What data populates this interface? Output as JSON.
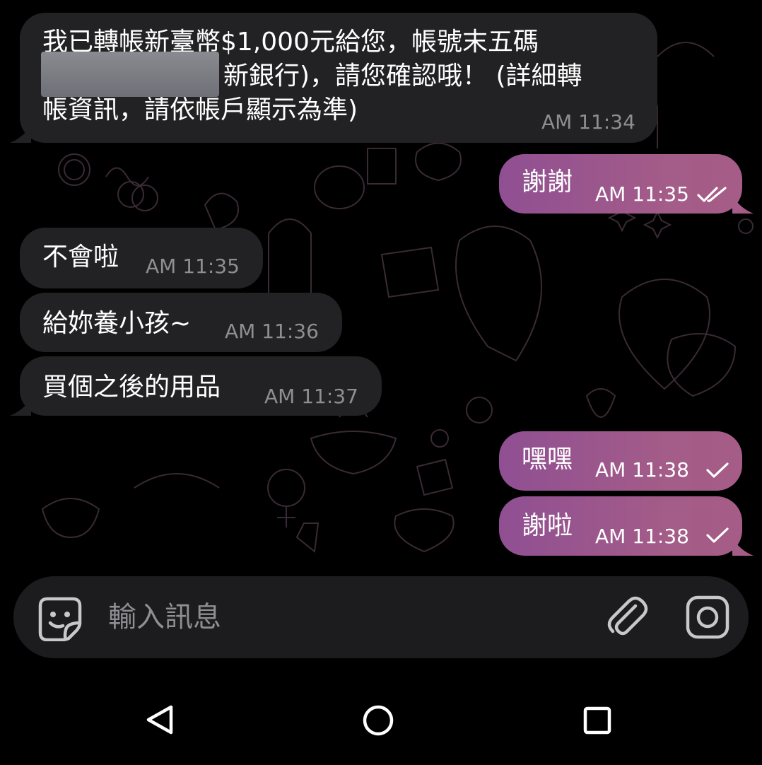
{
  "messages": [
    {
      "direction": "incoming",
      "lines": [
        "我已轉帳新臺幣$1,000元給您，帳號末五碼",
        "新銀行)，請您確認哦！ (詳細轉",
        "帳資訊，請依帳戶顯示為準)"
      ],
      "time": "AM 11:34",
      "redacted": true
    },
    {
      "direction": "outgoing",
      "text": "謝謝",
      "time": "AM 11:35",
      "status": "read"
    },
    {
      "direction": "incoming",
      "text": "不會啦",
      "time": "AM 11:35"
    },
    {
      "direction": "incoming",
      "text": "給妳養小孩~",
      "time": "AM 11:36"
    },
    {
      "direction": "incoming",
      "text": "買個之後的用品",
      "time": "AM 11:37"
    },
    {
      "direction": "outgoing",
      "text": "嘿嘿",
      "time": "AM 11:38",
      "status": "sent"
    },
    {
      "direction": "outgoing",
      "text": "謝啦",
      "time": "AM 11:38",
      "status": "sent"
    }
  ],
  "composer": {
    "placeholder": "輸入訊息",
    "icons": [
      "sticker-icon",
      "attach-icon",
      "camera-icon"
    ]
  },
  "navbar": {
    "icons": [
      "back-icon",
      "home-icon",
      "recents-icon"
    ]
  },
  "colors": {
    "background": "#000000",
    "incoming_bubble": "#222224",
    "outgoing_bubble": "#984f8c",
    "timestamp_incoming": "#8e8e93",
    "placeholder": "#8e8e93",
    "icon": "#c7c7cc"
  }
}
